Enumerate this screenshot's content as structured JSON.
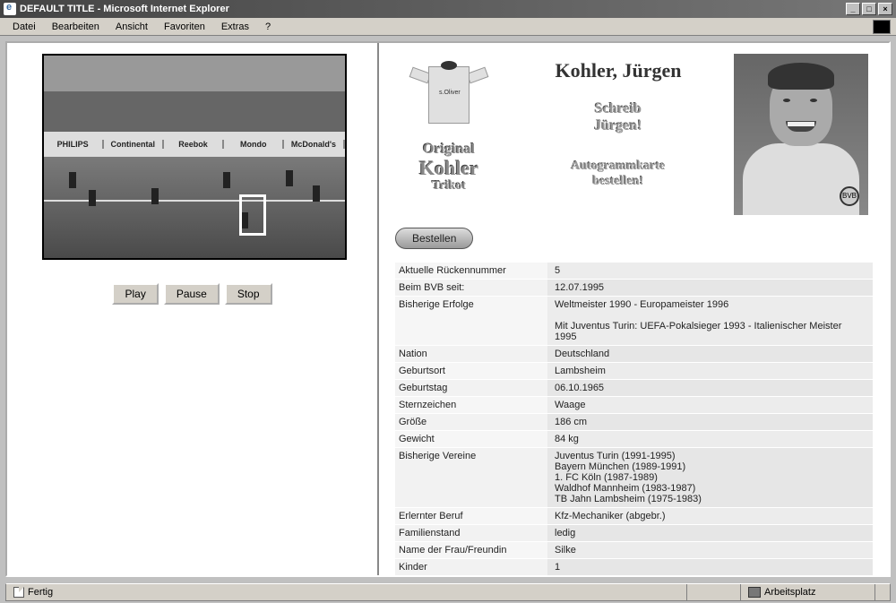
{
  "window": {
    "title": "DEFAULT TITLE - Microsoft Internet Explorer"
  },
  "menu": {
    "datei": "Datei",
    "bearbeiten": "Bearbeiten",
    "ansicht": "Ansicht",
    "favoriten": "Favoriten",
    "extras": "Extras",
    "help": "?"
  },
  "video": {
    "ads": [
      "PHILIPS",
      "Continental",
      "Reebok",
      "Mondo",
      "McDonald's"
    ],
    "controls": {
      "play": "Play",
      "pause": "Pause",
      "stop": "Stop"
    }
  },
  "profile": {
    "name": "Kohler, Jürgen",
    "trikot_l1": "Original",
    "trikot_l2": "Kohler",
    "trikot_l3": "Trikot",
    "schreib_l1": "Schreib",
    "schreib_l2": "Jürgen!",
    "auto_l1": "Autogrammkarte",
    "auto_l2": "bestellen!",
    "order_btn": "Bestellen",
    "jersey_logo": "s.Oliver",
    "badge": "BVB"
  },
  "info": [
    {
      "label": "Aktuelle Rückennummer",
      "value": "5"
    },
    {
      "label": "Beim BVB seit:",
      "value": "12.07.1995"
    },
    {
      "label": "Bisherige Erfolge",
      "value": "Weltmeister 1990 - Europameister 1996\n\nMit Juventus Turin: UEFA-Pokalsieger 1993 - Italienischer Meister 1995"
    },
    {
      "label": "Nation",
      "value": "Deutschland"
    },
    {
      "label": "Geburtsort",
      "value": "Lambsheim"
    },
    {
      "label": "Geburtstag",
      "value": "06.10.1965"
    },
    {
      "label": "Sternzeichen",
      "value": "Waage"
    },
    {
      "label": "Größe",
      "value": "186 cm"
    },
    {
      "label": "Gewicht",
      "value": "84 kg"
    },
    {
      "label": "Bisherige Vereine",
      "value": "Juventus Turin (1991-1995)\nBayern München (1989-1991)\n1. FC Köln (1987-1989)\nWaldhof Mannheim (1983-1987)\nTB Jahn Lambsheim (1975-1983)"
    },
    {
      "label": "Erlernter Beruf",
      "value": "Kfz-Mechaniker (abgebr.)"
    },
    {
      "label": "Familienstand",
      "value": "ledig"
    },
    {
      "label": "Name der Frau/Freundin",
      "value": "Silke"
    },
    {
      "label": "Kinder",
      "value": "1"
    }
  ],
  "status": {
    "ready": "Fertig",
    "zone": "Arbeitsplatz"
  }
}
